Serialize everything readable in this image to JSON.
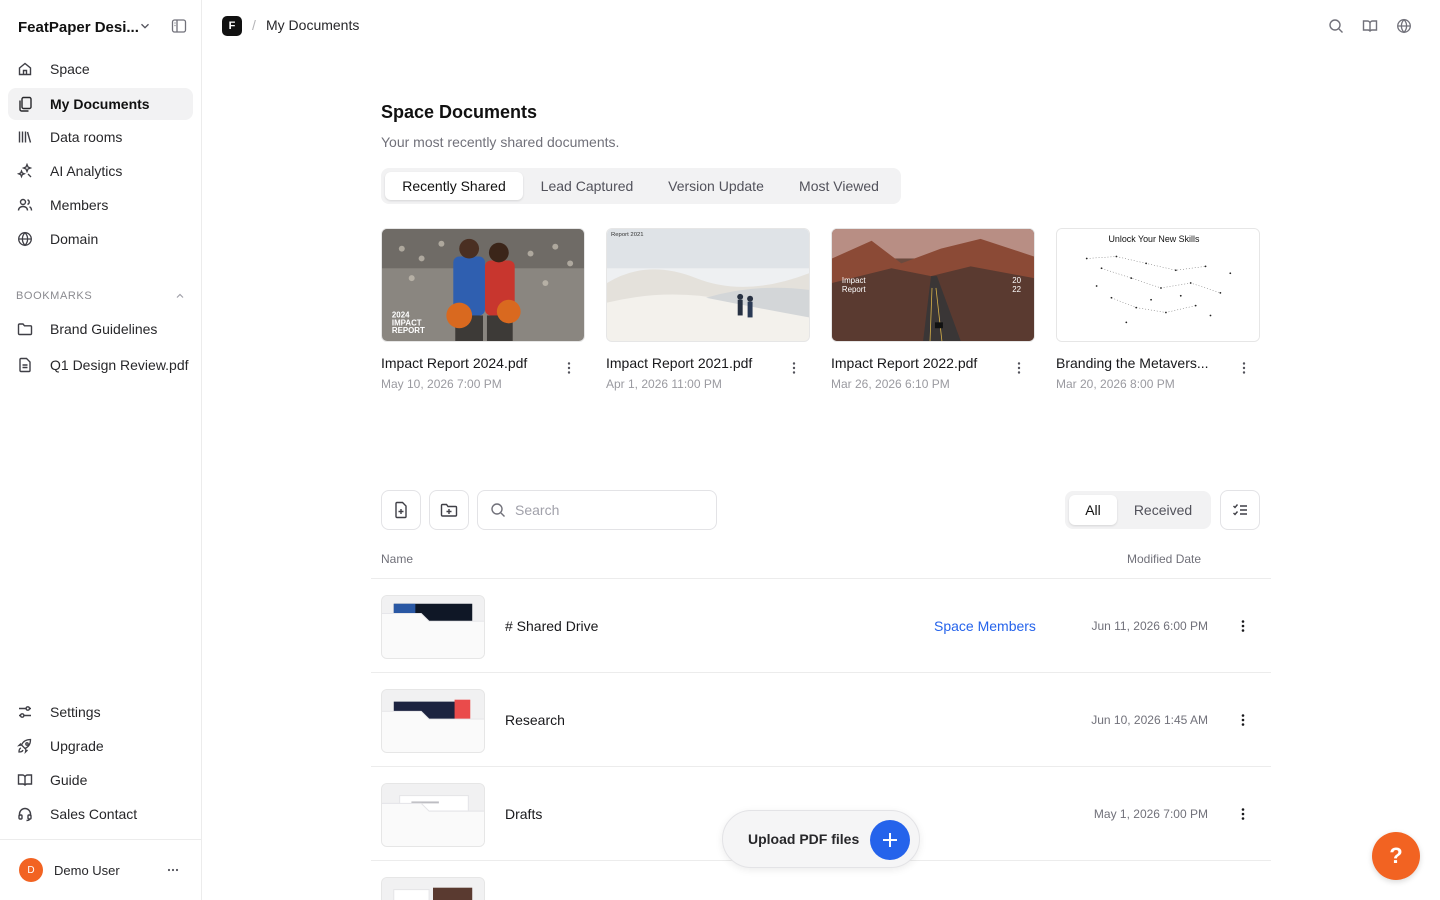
{
  "workspace": {
    "name": "FeatPaper Desi..."
  },
  "sidebar": {
    "items": [
      {
        "label": "Space",
        "icon": "home-icon"
      },
      {
        "label": "My Documents",
        "icon": "documents-icon",
        "active": true
      },
      {
        "label": "Data rooms",
        "icon": "library-icon"
      },
      {
        "label": "AI Analytics",
        "icon": "sparkles-icon"
      },
      {
        "label": "Members",
        "icon": "users-icon"
      },
      {
        "label": "Domain",
        "icon": "globe-icon"
      }
    ],
    "bookmarks_title": "BOOKMARKS",
    "bookmarks": [
      {
        "label": "Brand Guidelines",
        "icon": "folder-icon"
      },
      {
        "label": "Q1 Design Review.pdf",
        "icon": "file-icon"
      }
    ],
    "bottom_items": [
      {
        "label": "Settings",
        "icon": "settings-icon"
      },
      {
        "label": "Upgrade",
        "icon": "rocket-icon"
      },
      {
        "label": "Guide",
        "icon": "book-icon"
      },
      {
        "label": "Sales Contact",
        "icon": "headset-icon"
      }
    ],
    "user": {
      "initial": "D",
      "name": "Demo User"
    }
  },
  "topbar": {
    "logo_letter": "F",
    "separator": "/",
    "breadcrumb": "My Documents"
  },
  "space_documents": {
    "title": "Space Documents",
    "subtitle": "Your most recently shared documents.",
    "tabs": [
      "Recently Shared",
      "Lead Captured",
      "Version Update",
      "Most Viewed"
    ],
    "active_tab": "Recently Shared",
    "cards": [
      {
        "name": "Impact Report 2024.pdf",
        "date": "May 10, 2026 7:00 PM",
        "thumb_text": [
          "2024",
          "IMPACT",
          "REPORT"
        ]
      },
      {
        "name": "Impact Report 2021.pdf",
        "date": "Apr 1, 2026 11:00 PM",
        "thumb_text": [
          "Report 2021"
        ]
      },
      {
        "name": "Impact Report 2022.pdf",
        "date": "Mar 26, 2026 6:10 PM",
        "thumb_text": [
          "Impact",
          "Report",
          "20",
          "22"
        ]
      },
      {
        "name": "Branding the Metavers...",
        "date": "Mar 20, 2026 8:00 PM",
        "thumb_text": [
          "Unlock Your New Skills"
        ]
      }
    ]
  },
  "toolbar": {
    "search_placeholder": "Search",
    "filters": [
      "All",
      "Received"
    ],
    "active_filter": "All"
  },
  "table": {
    "headers": {
      "name": "Name",
      "modified": "Modified Date"
    },
    "rows": [
      {
        "name": "# Shared Drive",
        "tag": "Space Members",
        "date": "Jun 11, 2026 6:00 PM"
      },
      {
        "name": "Research",
        "tag": "",
        "date": "Jun 10, 2026 1:45 AM"
      },
      {
        "name": "Drafts",
        "tag": "",
        "date": "May 1, 2026 7:00 PM"
      }
    ]
  },
  "upload": {
    "label": "Upload PDF files"
  },
  "help": {
    "label": "?"
  },
  "colors": {
    "accent": "#2563eb",
    "brand_orange": "#f26322"
  }
}
